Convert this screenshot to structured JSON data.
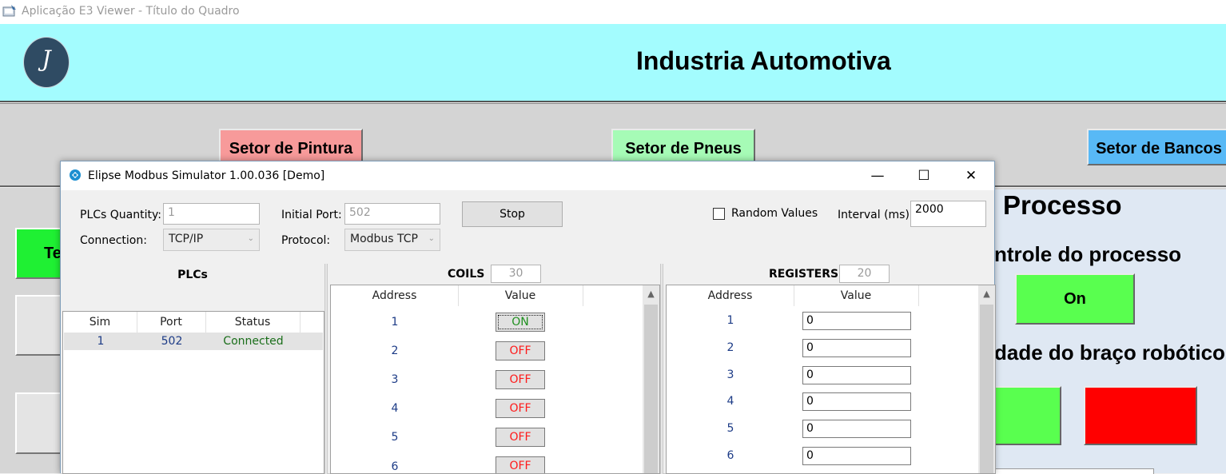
{
  "app": {
    "title": "Aplicação E3 Viewer - Título do Quadro",
    "logo_letter": "J",
    "header_title": "Industria Automotiva",
    "sectors": {
      "pintura": "Setor de Pintura",
      "pneus": "Setor de Pneus",
      "bancos": "Setor de Bancos"
    },
    "left_button_partial": "Te",
    "panel": {
      "title_partial": "Processo",
      "controle_partial": "ntrole do processo",
      "on_button": "On",
      "velocidade_partial": "dade do braço robótico"
    },
    "colors": {
      "header_band": "#a3fcfe",
      "pintura": "#f79a9a",
      "pneus": "#a6fbb6",
      "bancos": "#58b9f6",
      "on_green": "#59ff4f",
      "red": "#ff0000"
    }
  },
  "simulator": {
    "title": "Elipse Modbus Simulator 1.00.036 [Demo]",
    "controls": {
      "minimize": "—",
      "maximize": "☐",
      "close": "✕"
    },
    "plcs_quantity_label": "PLCs Quantity:",
    "plcs_quantity_value": "1",
    "initial_port_label": "Initial Port:",
    "initial_port_value": "502",
    "stop_button": "Stop",
    "random_values_label": "Random Values",
    "random_values_checked": false,
    "interval_label": "Interval (ms):",
    "interval_value": "2000",
    "connection_label": "Connection:",
    "connection_value": "TCP/IP",
    "protocol_label": "Protocol:",
    "protocol_value": "Modbus TCP",
    "plcs": {
      "header": "PLCs",
      "columns": [
        "Sim",
        "Port",
        "Status"
      ],
      "rows": [
        {
          "sim": "1",
          "port": "502",
          "status": "Connected"
        }
      ]
    },
    "coils": {
      "label": "COILS",
      "count": "30",
      "columns": [
        "Address",
        "Value"
      ],
      "rows": [
        {
          "address": "1",
          "value": "ON"
        },
        {
          "address": "2",
          "value": "OFF"
        },
        {
          "address": "3",
          "value": "OFF"
        },
        {
          "address": "4",
          "value": "OFF"
        },
        {
          "address": "5",
          "value": "OFF"
        },
        {
          "address": "6",
          "value": "OFF"
        }
      ]
    },
    "registers": {
      "label": "REGISTERS",
      "count": "20",
      "columns": [
        "Address",
        "Value"
      ],
      "rows": [
        {
          "address": "1",
          "value": "0"
        },
        {
          "address": "2",
          "value": "0"
        },
        {
          "address": "3",
          "value": "0"
        },
        {
          "address": "4",
          "value": "0"
        },
        {
          "address": "5",
          "value": "0"
        },
        {
          "address": "6",
          "value": "0"
        }
      ]
    }
  }
}
